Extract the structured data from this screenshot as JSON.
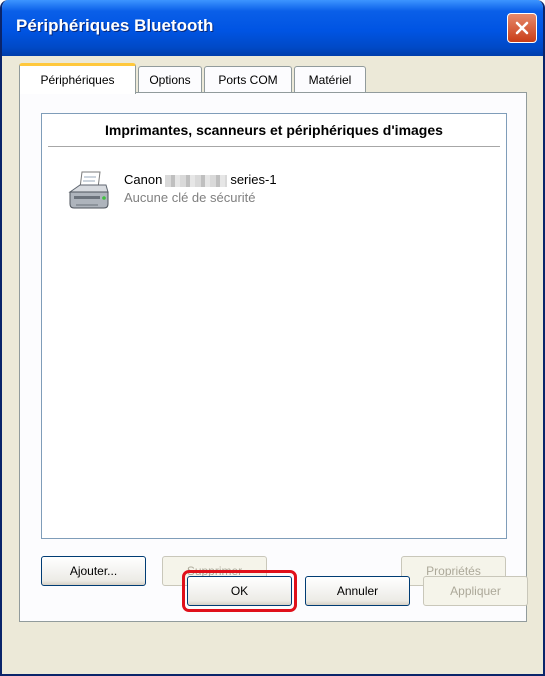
{
  "window": {
    "title": "Périphériques Bluetooth"
  },
  "tabs": [
    {
      "label": "Périphériques",
      "active": true
    },
    {
      "label": "Options",
      "active": false
    },
    {
      "label": "Ports COM",
      "active": false
    },
    {
      "label": "Matériel",
      "active": false
    }
  ],
  "device_list": {
    "group_header": "Imprimantes, scanneurs et périphériques d'images",
    "devices": [
      {
        "name_prefix": "Canon",
        "name_suffix": "series-1",
        "status": "Aucune clé de sécurité",
        "icon": "printer-icon"
      }
    ]
  },
  "panel_buttons": {
    "add": "Ajouter...",
    "remove": "Supprimer",
    "properties": "Propriétés"
  },
  "dialog_buttons": {
    "ok": "OK",
    "cancel": "Annuler",
    "apply": "Appliquer"
  },
  "colors": {
    "titlebar": "#0054e3",
    "highlight": "#e0101a",
    "active_tab_accent": "#ffc83c"
  }
}
